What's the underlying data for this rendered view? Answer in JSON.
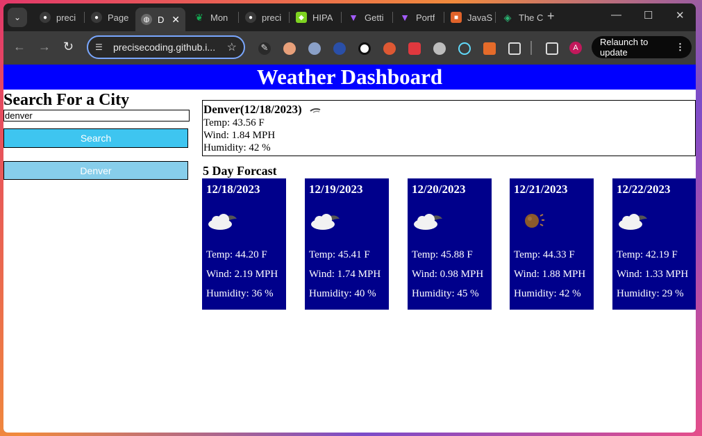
{
  "browser": {
    "tabs": [
      {
        "title": "preci",
        "favicon": "github-icon",
        "color": "#3a3a3a"
      },
      {
        "title": "Page",
        "favicon": "github-icon",
        "color": "#3a3a3a"
      },
      {
        "title": "D",
        "favicon": "globe-icon",
        "color": "#6a6a6a",
        "active": true
      },
      {
        "title": "Mon",
        "favicon": "mongodb-leaf-icon",
        "color": "#13aa52"
      },
      {
        "title": "preci",
        "favicon": "github-icon",
        "color": "#3a3a3a"
      },
      {
        "title": "HIPA",
        "favicon": "shield-icon",
        "color": "#7ed321"
      },
      {
        "title": "Getti",
        "favicon": "vite-icon",
        "color": "#a35cff"
      },
      {
        "title": "Portf",
        "favicon": "vite-icon",
        "color": "#a35cff"
      },
      {
        "title": "JavaS",
        "favicon": "js-icon",
        "color": "#e0632a"
      },
      {
        "title": "The C",
        "favicon": "layers-icon",
        "color": "#2bb673"
      }
    ],
    "url": "precisecoding.github.i...",
    "relaunch_label": "Relaunch to update",
    "avatar_letter": "A"
  },
  "page": {
    "title": "Weather Dashboard",
    "search": {
      "heading": "Search For a City",
      "value": "denver",
      "button_label": "Search"
    },
    "history": [
      "Denver"
    ],
    "current": {
      "heading": "Denver(12/18/2023)",
      "icon": "clear-night-icon",
      "temp": "Temp: 43.56 F",
      "wind": "Wind: 1.84 MPH",
      "humidity": "Humidity: 42 %"
    },
    "forecast_title": "5 Day Forcast",
    "forecast": [
      {
        "date": "12/18/2023",
        "icon": "cloudy-night-icon",
        "temp": "Temp: 44.20 F",
        "wind": "Wind: 2.19 MPH",
        "humidity": "Humidity: 36 %"
      },
      {
        "date": "12/19/2023",
        "icon": "cloudy-night-icon",
        "temp": "Temp: 45.41 F",
        "wind": "Wind: 1.74 MPH",
        "humidity": "Humidity: 40 %"
      },
      {
        "date": "12/20/2023",
        "icon": "cloudy-night-icon",
        "temp": "Temp: 45.88 F",
        "wind": "Wind: 0.98 MPH",
        "humidity": "Humidity: 45 %"
      },
      {
        "date": "12/21/2023",
        "icon": "partly-cloudy-night-icon",
        "temp": "Temp: 44.33 F",
        "wind": "Wind: 1.88 MPH",
        "humidity": "Humidity: 42 %"
      },
      {
        "date": "12/22/2023",
        "icon": "cloudy-night-icon",
        "temp": "Temp: 42.19 F",
        "wind": "Wind: 1.33 MPH",
        "humidity": "Humidity: 29 %"
      }
    ]
  }
}
